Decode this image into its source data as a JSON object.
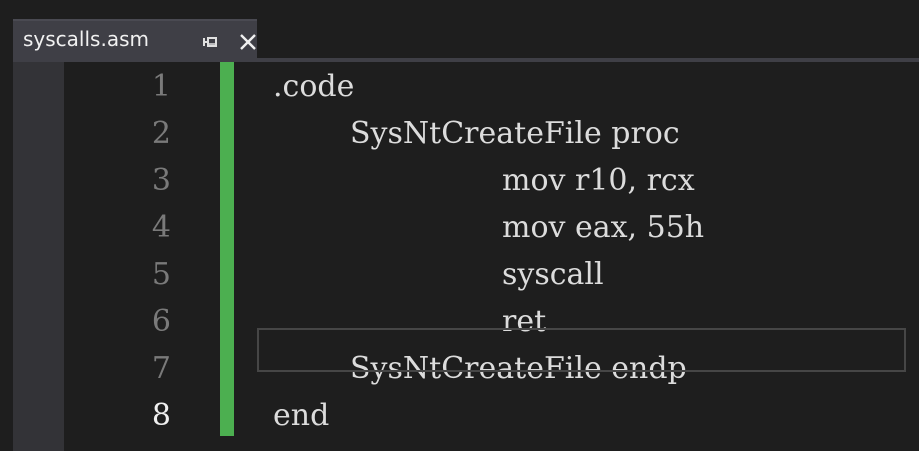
{
  "tab": {
    "title": "syscalls.asm",
    "pin_icon": "pin-icon",
    "close_icon": "close-icon"
  },
  "editor": {
    "current_line": 8,
    "change_bar_color": "#4caf50",
    "lines": [
      {
        "number": "1",
        "text": ".code",
        "indent": 0
      },
      {
        "number": "2",
        "text": "SysNtCreateFile proc",
        "indent": 1
      },
      {
        "number": "3",
        "text": "mov r10, rcx",
        "indent": 2
      },
      {
        "number": "4",
        "text": "mov eax, 55h",
        "indent": 2
      },
      {
        "number": "5",
        "text": "syscall",
        "indent": 2
      },
      {
        "number": "6",
        "text": "ret",
        "indent": 2
      },
      {
        "number": "7",
        "text": "SysNtCreateFile endp",
        "indent": 1
      },
      {
        "number": "8",
        "text": "end",
        "indent": 0
      }
    ]
  }
}
